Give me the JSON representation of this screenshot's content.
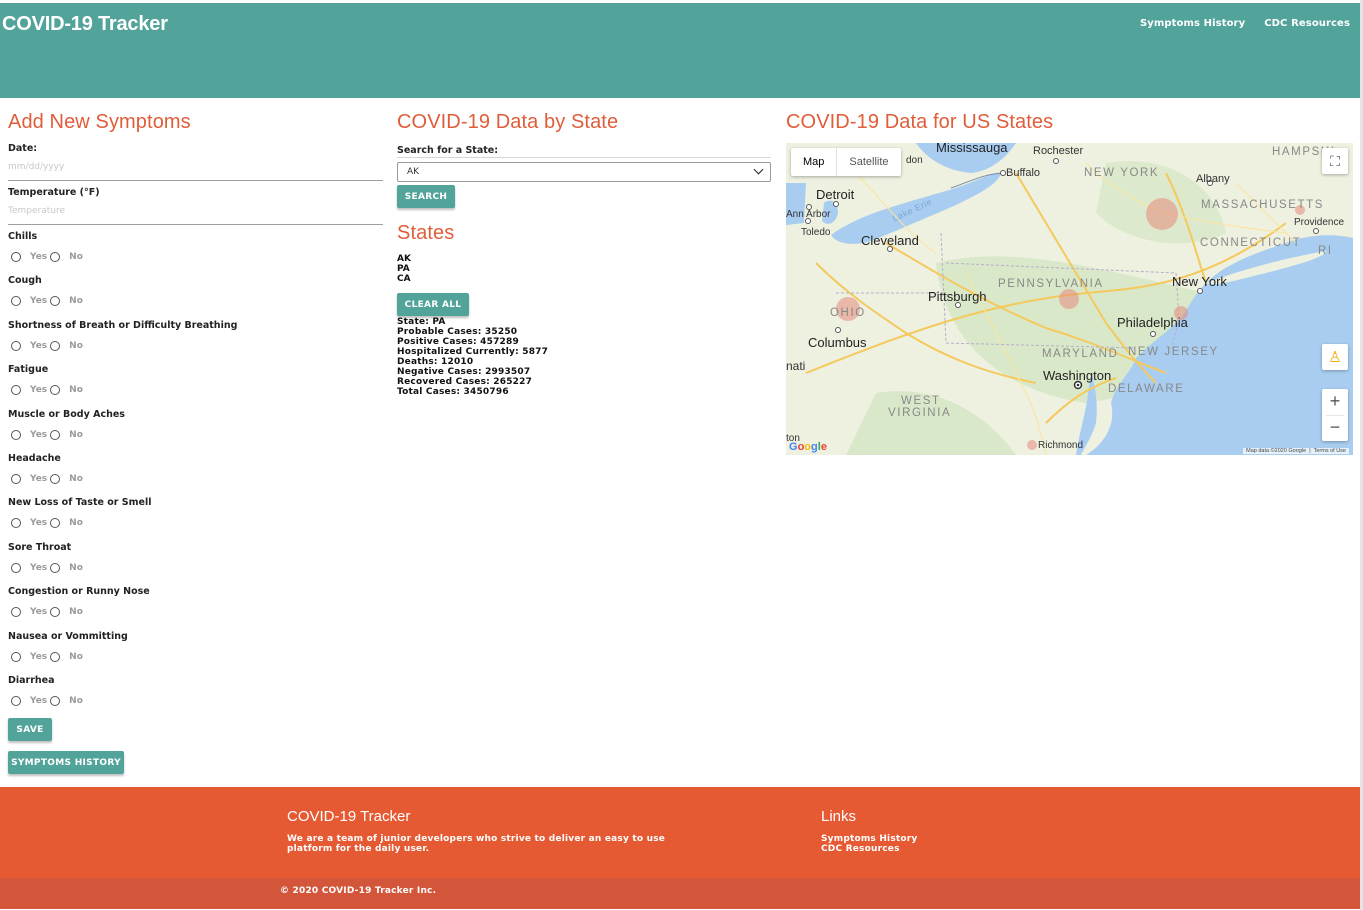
{
  "app": {
    "title": "COVID-19 Tracker"
  },
  "nav": {
    "links": [
      "Symptoms History",
      "CDC Resources"
    ]
  },
  "symptoms_form": {
    "heading": "Add New Symptoms",
    "date": {
      "label": "Date:",
      "placeholder": "mm/dd/yyyy"
    },
    "temperature": {
      "label": "Temperature (°F)",
      "placeholder": "Temperature"
    },
    "yes_label": "Yes",
    "no_label": "No",
    "questions": [
      "Chills",
      "Cough",
      "Shortness of Breath or Difficulty Breathing",
      "Fatigue",
      "Muscle or Body Aches",
      "Headache",
      "New Loss of Taste or Smell",
      "Sore Throat",
      "Congestion or Runny Nose",
      "Nausea or Vommitting",
      "Diarrhea"
    ],
    "save_label": "SAVE",
    "history_label": "SYMPTOMS HISTORY"
  },
  "state_data": {
    "heading": "COVID-19 Data by State",
    "search_label": "Search for a State:",
    "selected": "AK",
    "search_button": "SEARCH",
    "states_heading": "States",
    "states": [
      "AK",
      "PA",
      "CA"
    ],
    "clear_button": "CLEAR ALL",
    "stats": [
      "State: PA",
      "Probable Cases: 35250",
      "Positive Cases: 457289",
      "Hospitalized Currently: 5877",
      "Deaths: 12010",
      "Negative Cases: 2993507",
      "Recovered Cases: 265227",
      "Total Cases: 3450796"
    ]
  },
  "map": {
    "heading": "COVID-19 Data for US States",
    "tabs": [
      "Map",
      "Satellite"
    ],
    "attribution": "Map data ©2020 Google",
    "terms": "Terms of Use",
    "google": "Google",
    "cities": [
      "Mississauga",
      "Rochester",
      "Buffalo",
      "Albany",
      "Detroit",
      "Ann Arbor",
      "Toledo",
      "Cleveland",
      "Providence",
      "Pittsburgh",
      "New York",
      "Columbus",
      "Philadelphia",
      "Washington",
      "Richmond",
      "nati",
      "ton",
      "don"
    ],
    "regions": [
      "NEW YORK",
      "MASSACHUSETTS",
      "CONNECTICUT",
      "RI",
      "PENNSYLVANIA",
      "OHIO",
      "MARYLAND",
      "NEW JERSEY",
      "DELAWARE",
      "WEST",
      "VIRGINIA",
      "HAMPSHI",
      "Lake Erie"
    ],
    "colors": {
      "water": "#a9cdf0",
      "land": "#eef0e0",
      "marker": "#e58b7b"
    }
  },
  "footer": {
    "title": "COVID-19 Tracker",
    "text_line1": "We are a team of junior developers who strive to deliver an easy to use",
    "text_line2": "platform for the daily user.",
    "links_title": "Links",
    "links": [
      "Symptoms History",
      "CDC Resources"
    ],
    "copyright": "© 2020 COVID-19 Tracker Inc."
  },
  "colors": {
    "teal": "#52a49a",
    "orange": "#e65a33",
    "heading": "#e05d3a"
  }
}
